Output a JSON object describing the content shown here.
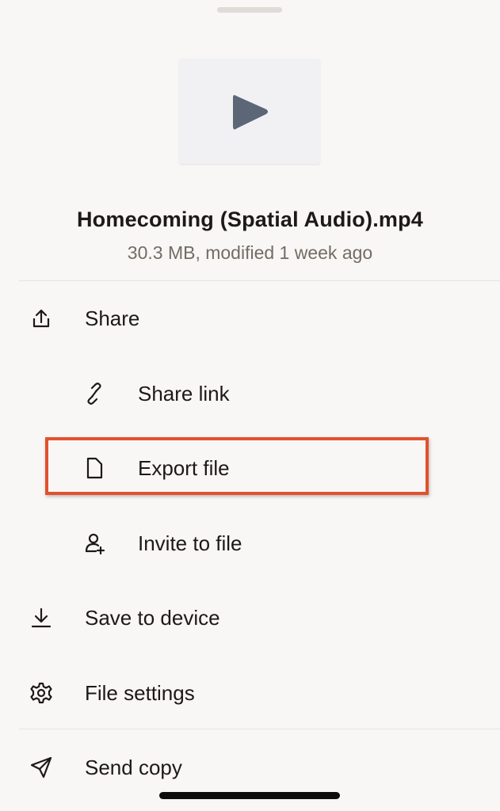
{
  "file": {
    "name": "Homecoming (Spatial Audio).mp4",
    "meta": "30.3 MB, modified 1 week ago"
  },
  "menu": {
    "share": "Share",
    "share_link": "Share link",
    "export_file": "Export file",
    "invite_to_file": "Invite to file",
    "save_to_device": "Save to device",
    "file_settings": "File settings",
    "send_copy": "Send copy"
  },
  "icons": {
    "share": "share-icon",
    "share_link": "link-icon",
    "export_file": "file-icon",
    "invite_to_file": "add-person-icon",
    "save_to_device": "download-icon",
    "file_settings": "gear-icon",
    "send_copy": "paper-plane-icon",
    "thumbnail": "play-icon"
  },
  "colors": {
    "background": "#f8f7f5",
    "text": "#1e1919",
    "meta_text": "#736c64",
    "highlight": "#e2512e",
    "play_icon": "#5b6677"
  }
}
